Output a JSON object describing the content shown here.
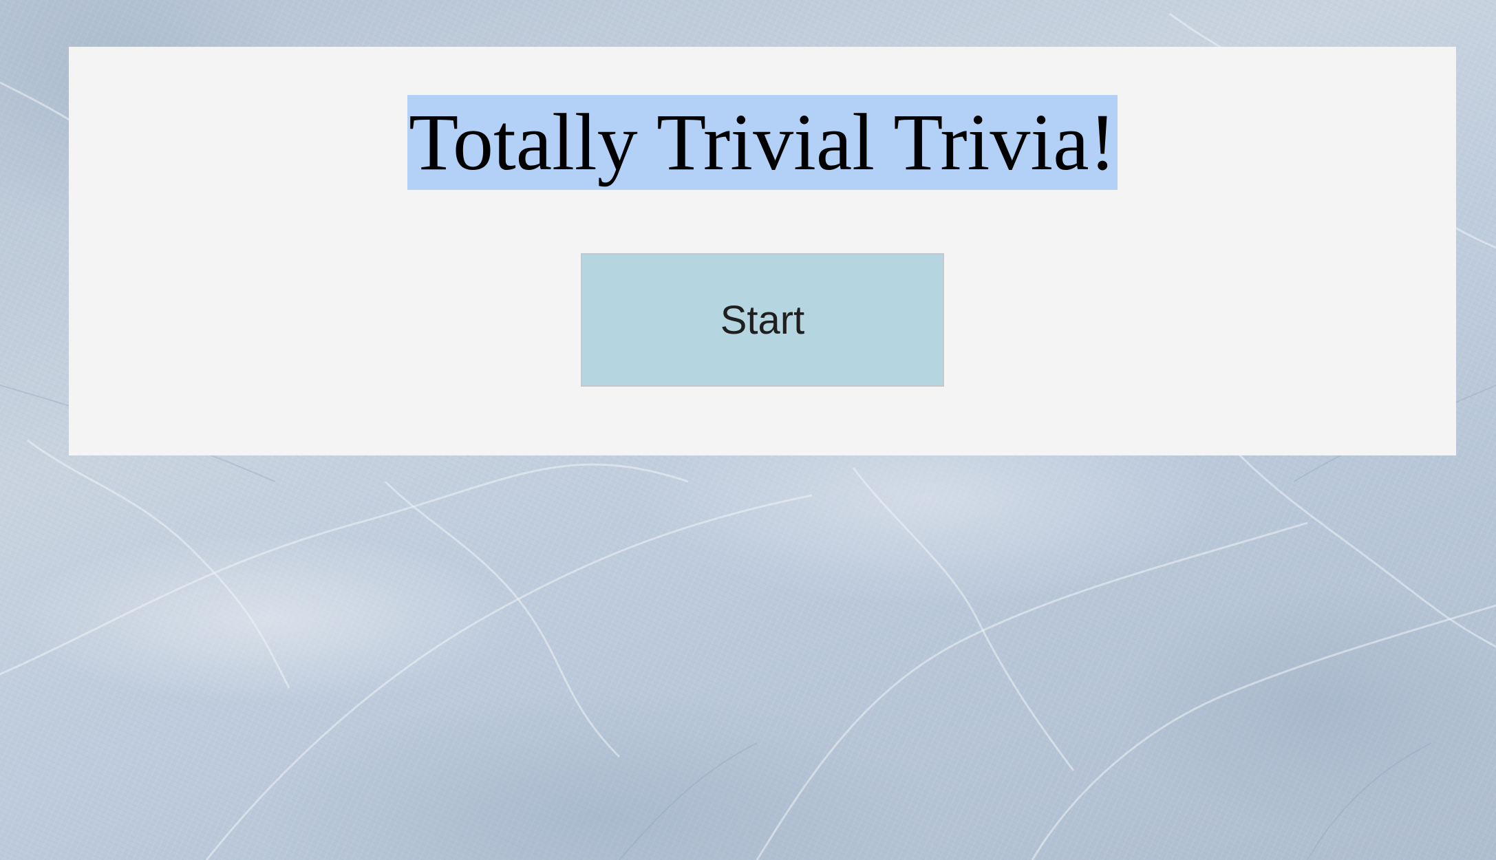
{
  "page": {
    "title": "Totally Trivial Trivia!",
    "start_label": "Start"
  },
  "colors": {
    "panel_background": "#f4f4f4",
    "title_highlight": "#b3d1f7",
    "start_button_background": "#b5d6e0",
    "page_background": "#c3cfdc"
  }
}
